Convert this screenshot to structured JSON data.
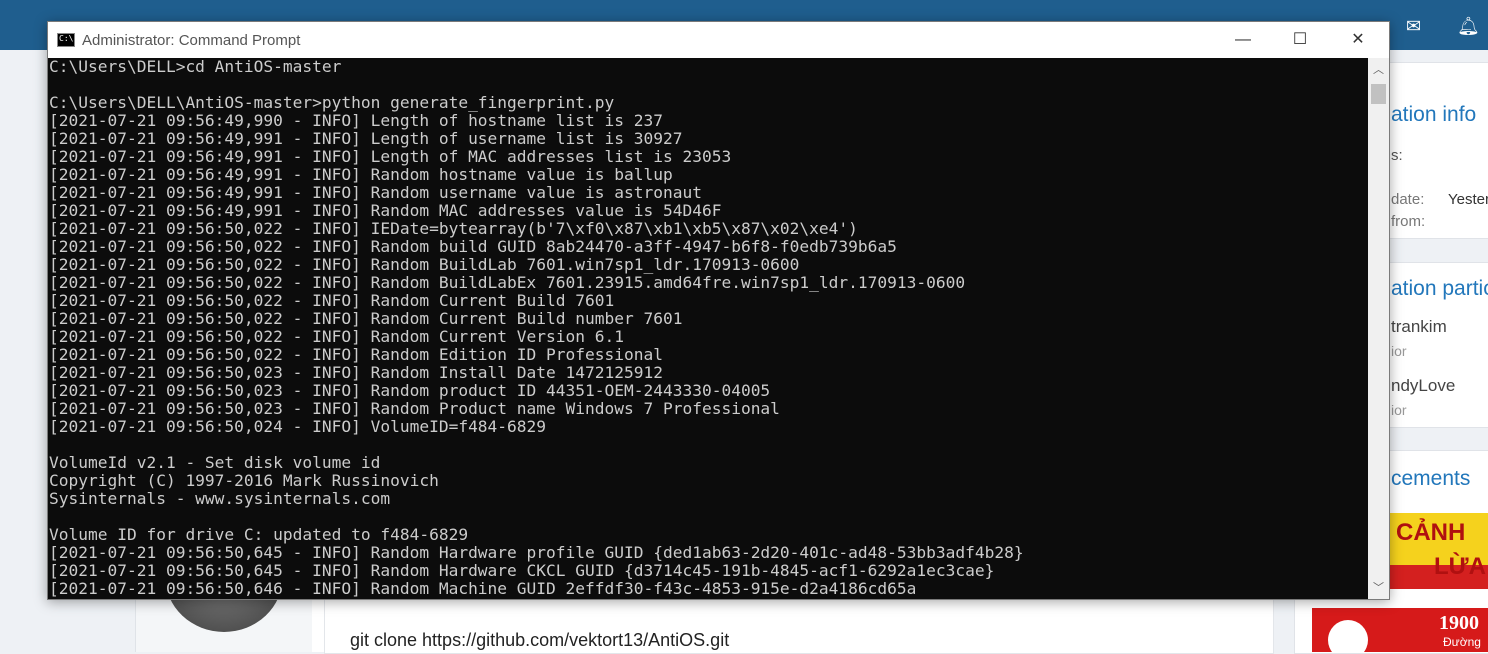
{
  "forum": {
    "post_text": "git clone https://github.com/vektort13/AntiOS.git",
    "sidebar_info": {
      "title": "ation info",
      "row1": "s:",
      "row2_label": "date:",
      "row2_value": "Yester",
      "row3_label": "from:"
    },
    "sidebar_participants": {
      "title": "ation partic",
      "user1": "trankim",
      "user1_role": "ior",
      "user2": "ndyLove",
      "user2_role": "ior"
    },
    "sidebar_ads": {
      "title": "cements",
      "ad1_line1": "CẢNH",
      "ad1_line2": "LỪA",
      "ad2_line1": "1900",
      "ad2_line2": "Đường"
    },
    "topbar_icons": [
      "mail-icon",
      "bell-icon"
    ]
  },
  "window": {
    "title": "Administrator: Command Prompt",
    "minimize": "—",
    "maximize": "☐",
    "close": "✕",
    "icon_text": "C:\\"
  },
  "console": {
    "lines": [
      "C:\\Users\\DELL>cd AntiOS-master",
      "",
      "C:\\Users\\DELL\\AntiOS-master>python generate_fingerprint.py",
      "[2021-07-21 09:56:49,990 - INFO] Length of hostname list is 237",
      "[2021-07-21 09:56:49,991 - INFO] Length of username list is 30927",
      "[2021-07-21 09:56:49,991 - INFO] Length of MAC addresses list is 23053",
      "[2021-07-21 09:56:49,991 - INFO] Random hostname value is ballup",
      "[2021-07-21 09:56:49,991 - INFO] Random username value is astronaut",
      "[2021-07-21 09:56:49,991 - INFO] Random MAC addresses value is 54D46F",
      "[2021-07-21 09:56:50,022 - INFO] IEDate=bytearray(b'7\\xf0\\x87\\xb1\\xb5\\x87\\x02\\xe4')",
      "[2021-07-21 09:56:50,022 - INFO] Random build GUID 8ab24470-a3ff-4947-b6f8-f0edb739b6a5",
      "[2021-07-21 09:56:50,022 - INFO] Random BuildLab 7601.win7sp1_ldr.170913-0600",
      "[2021-07-21 09:56:50,022 - INFO] Random BuildLabEx 7601.23915.amd64fre.win7sp1_ldr.170913-0600",
      "[2021-07-21 09:56:50,022 - INFO] Random Current Build 7601",
      "[2021-07-21 09:56:50,022 - INFO] Random Current Build number 7601",
      "[2021-07-21 09:56:50,022 - INFO] Random Current Version 6.1",
      "[2021-07-21 09:56:50,022 - INFO] Random Edition ID Professional",
      "[2021-07-21 09:56:50,023 - INFO] Random Install Date 1472125912",
      "[2021-07-21 09:56:50,023 - INFO] Random product ID 44351-OEM-2443330-04005",
      "[2021-07-21 09:56:50,023 - INFO] Random Product name Windows 7 Professional",
      "[2021-07-21 09:56:50,024 - INFO] VolumeID=f484-6829",
      "",
      "VolumeId v2.1 - Set disk volume id",
      "Copyright (C) 1997-2016 Mark Russinovich",
      "Sysinternals - www.sysinternals.com",
      "",
      "Volume ID for drive C: updated to f484-6829",
      "[2021-07-21 09:56:50,645 - INFO] Random Hardware profile GUID {ded1ab63-2d20-401c-ad48-53bb3adf4b28}",
      "[2021-07-21 09:56:50,645 - INFO] Random Hardware CKCL GUID {d3714c45-191b-4845-acf1-6292a1ec3cae}",
      "[2021-07-21 09:56:50,646 - INFO] Random Machine GUID 2effdf30-f43c-4853-915e-d2a4186cd65a"
    ]
  }
}
